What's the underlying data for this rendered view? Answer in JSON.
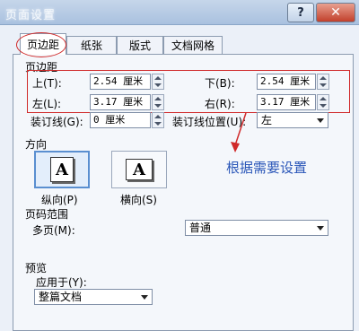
{
  "window": {
    "title": "页面设置",
    "help_label": "?",
    "close_label": "✕"
  },
  "tabs": [
    {
      "label": "页边距"
    },
    {
      "label": "纸张"
    },
    {
      "label": "版式"
    },
    {
      "label": "文档网格"
    }
  ],
  "margins": {
    "section_label": "页边距",
    "top_label": "上(T):",
    "top_value": "2.54 厘米",
    "bottom_label": "下(B):",
    "bottom_value": "2.54 厘米",
    "left_label": "左(L):",
    "left_value": "3.17 厘米",
    "right_label": "右(R):",
    "right_value": "3.17 厘米",
    "gutter_label": "装订线(G):",
    "gutter_value": "0 厘米",
    "gutter_pos_label": "装订线位置(U):",
    "gutter_pos_value": "左"
  },
  "orientation": {
    "section_label": "方向",
    "portrait_label": "纵向(P)",
    "landscape_label": "横向(S)",
    "icon_letter": "A"
  },
  "annotation": {
    "hint": "根据需要设置",
    "accent_color": "#d02a2a"
  },
  "pages": {
    "section_label": "页码范围",
    "multi_label": "多页(M):",
    "multi_value": "普通"
  },
  "preview": {
    "section_label": "预览",
    "apply_label": "应用于(Y):",
    "apply_value": "整篇文档"
  }
}
